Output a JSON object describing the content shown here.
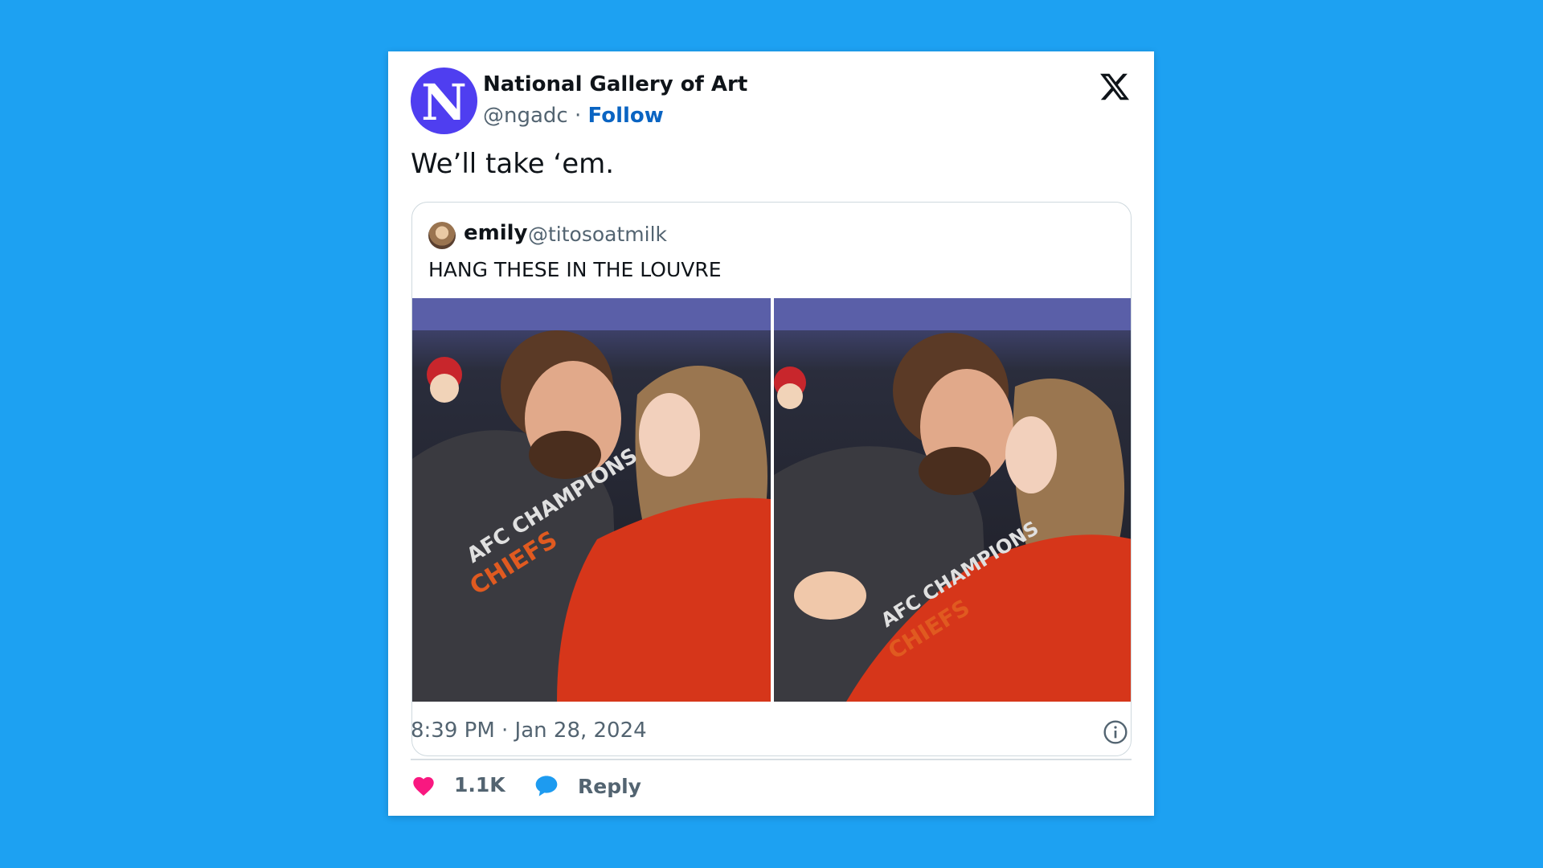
{
  "tweet": {
    "author": {
      "avatar_letter": "N",
      "display_name": "National Gallery of Art",
      "handle": "@ngadc",
      "separator": "·",
      "follow_label": "Follow"
    },
    "text": "We’ll take ‘em.",
    "quoted": {
      "display_name": "emily",
      "handle": "@titosoatmilk",
      "text": "HANG THESE IN THE LOUVRE",
      "image_count": 2
    },
    "timestamp": "8:39 PM · Jan 28, 2024",
    "actions": {
      "like_count": "1.1K",
      "reply_label": "Reply"
    }
  },
  "icons": {
    "brand": "x-logo-icon",
    "info": "info-icon",
    "like": "heart-icon",
    "reply": "speech-bubble-icon"
  },
  "colors": {
    "page_background": "#1da1f2",
    "avatar_background": "#4f3ef0",
    "follow_link": "#0a64c2",
    "heart": "#f91880",
    "reply_bubble": "#1d9bf0",
    "secondary_text": "#536471"
  }
}
